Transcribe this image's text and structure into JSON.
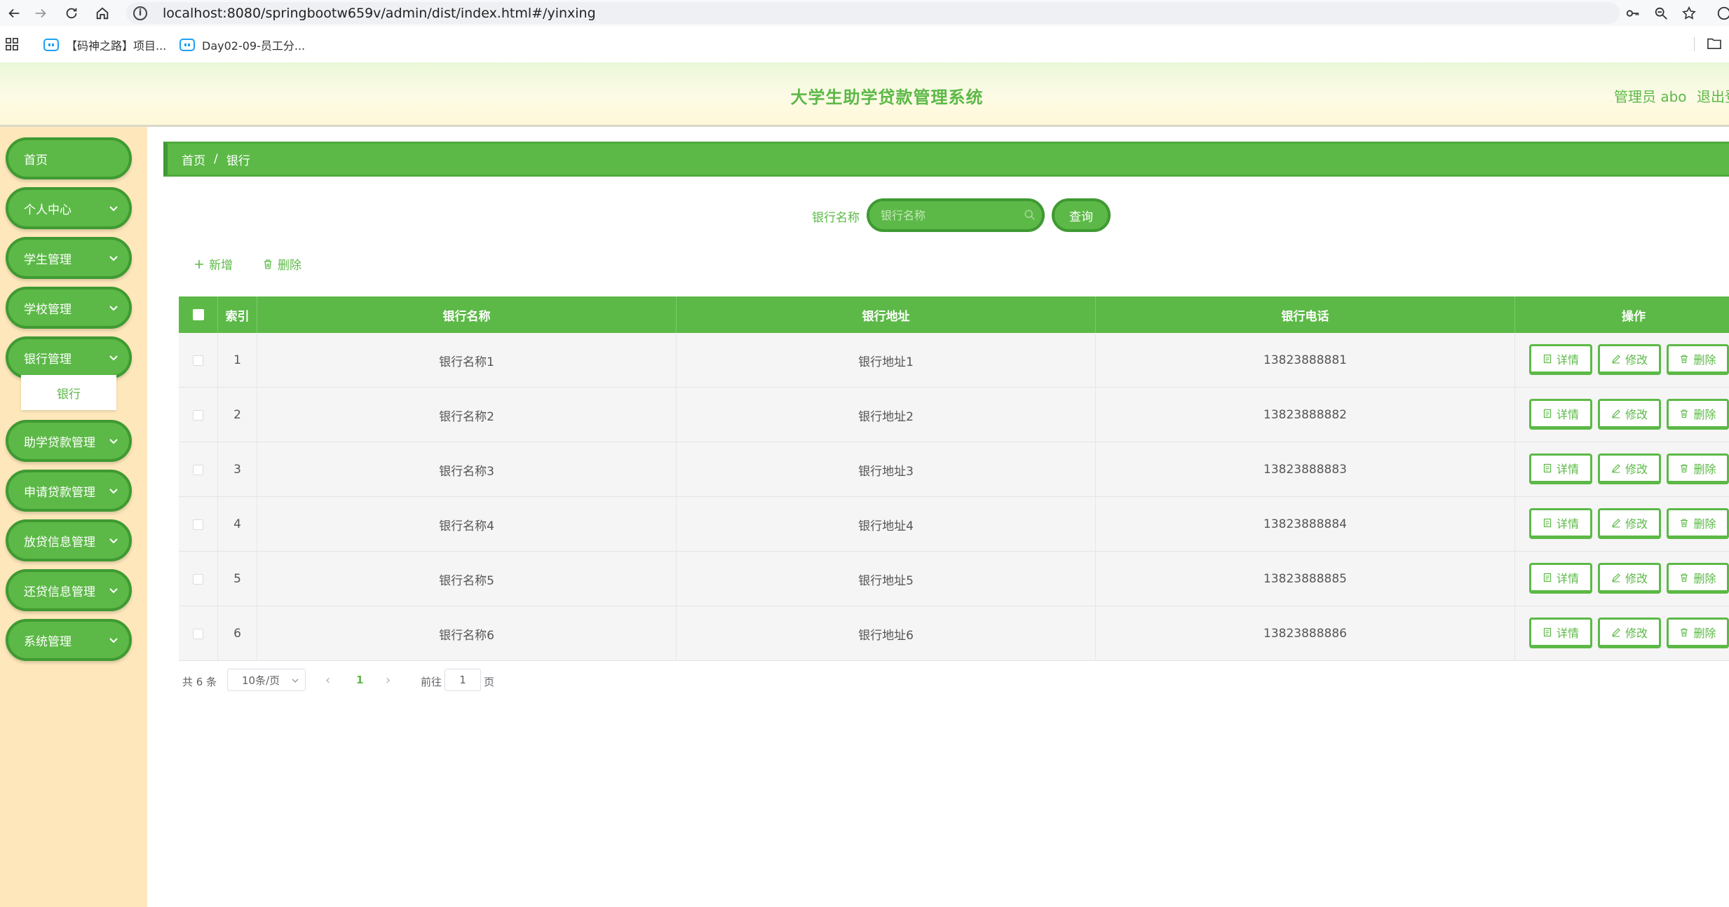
{
  "browser": {
    "url": "localhost:8080/springbootw659v/admin/dist/index.html#/yinxing",
    "bookmarks": [
      "【码神之路】项目...",
      "Day02-09-员工分..."
    ]
  },
  "header": {
    "title": "大学生助学贷款管理系统",
    "user": "管理员 abo",
    "logout": "退出登录"
  },
  "sidebar": {
    "items": [
      {
        "label": "首页"
      },
      {
        "label": "个人中心"
      },
      {
        "label": "学生管理"
      },
      {
        "label": "学校管理"
      },
      {
        "label": "银行管理"
      },
      {
        "label": "助学贷款管理"
      },
      {
        "label": "申请贷款管理"
      },
      {
        "label": "放贷信息管理"
      },
      {
        "label": "还贷信息管理"
      },
      {
        "label": "系统管理"
      }
    ],
    "submenu": "银行"
  },
  "breadcrumb": {
    "home": "首页",
    "sep": "/",
    "current": "银行"
  },
  "search": {
    "label": "银行名称",
    "placeholder": "银行名称",
    "button": "查询"
  },
  "toolbar": {
    "add": "新增",
    "delete": "删除"
  },
  "table": {
    "columns": [
      "索引",
      "银行名称",
      "银行地址",
      "银行电话",
      "操作"
    ],
    "rows": [
      {
        "index": "1",
        "name": "银行名称1",
        "address": "银行地址1",
        "phone": "13823888881"
      },
      {
        "index": "2",
        "name": "银行名称2",
        "address": "银行地址2",
        "phone": "13823888882"
      },
      {
        "index": "3",
        "name": "银行名称3",
        "address": "银行地址3",
        "phone": "13823888883"
      },
      {
        "index": "4",
        "name": "银行名称4",
        "address": "银行地址4",
        "phone": "13823888884"
      },
      {
        "index": "5",
        "name": "银行名称5",
        "address": "银行地址5",
        "phone": "13823888885"
      },
      {
        "index": "6",
        "name": "银行名称6",
        "address": "银行地址6",
        "phone": "13823888886"
      }
    ],
    "actions": {
      "detail": "详情",
      "edit": "修改",
      "delete": "删除"
    }
  },
  "pagination": {
    "total": "共 6 条",
    "page_size": "10条/页",
    "current": "1",
    "goto_prefix": "前往",
    "goto_value": "1",
    "goto_suffix": "页"
  },
  "colors": {
    "primary": "#5cb947",
    "primary_dark": "#3f9a32",
    "sidebar_bg": "#fee8bb"
  }
}
